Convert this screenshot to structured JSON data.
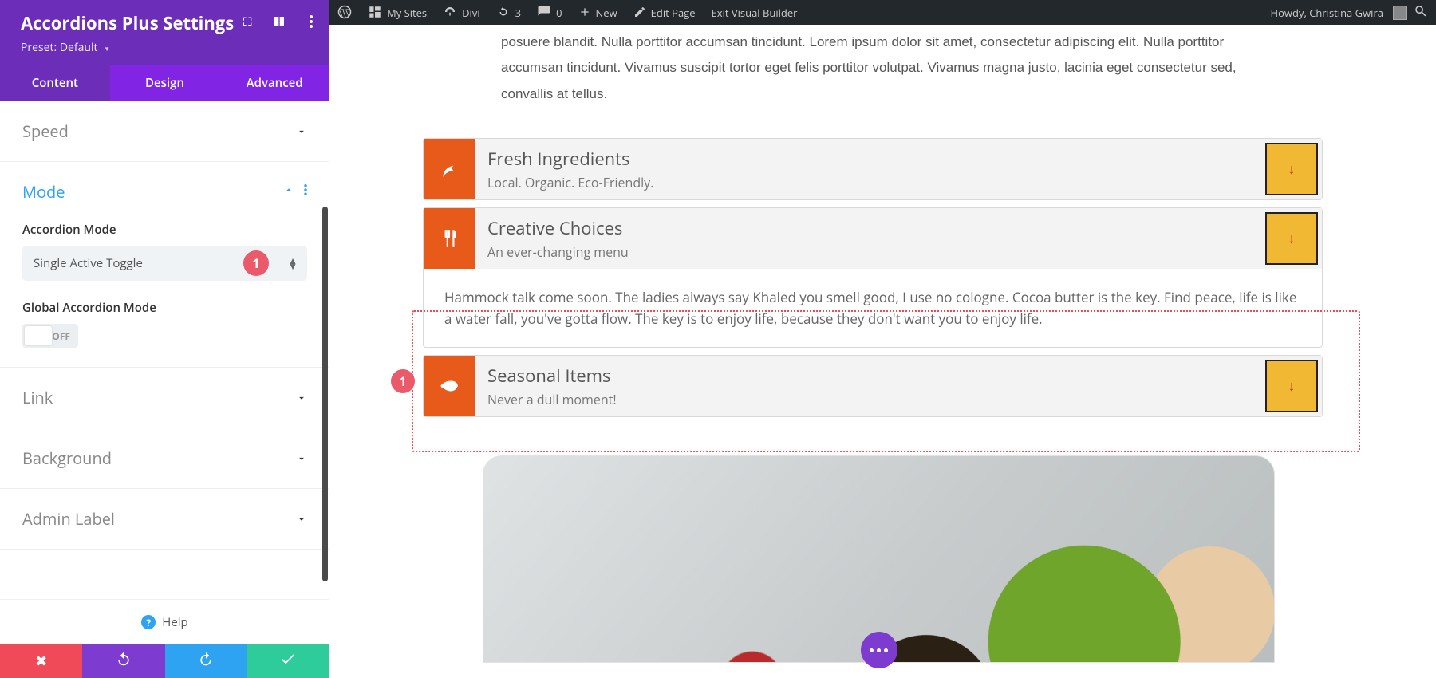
{
  "adminbar": {
    "mysites": "My Sites",
    "site": "Divi",
    "updates": "3",
    "comments": "0",
    "newlabel": "New",
    "editpage": "Edit Page",
    "exitvb": "Exit Visual Builder",
    "howdy": "Howdy, Christina Gwira"
  },
  "panel": {
    "title": "Accordions Plus Settings",
    "preset_label": "Preset:",
    "preset_value": "Default",
    "tabs": {
      "content": "Content",
      "design": "Design",
      "advanced": "Advanced"
    },
    "sections": {
      "speed": "Speed",
      "mode": "Mode",
      "link": "Link",
      "background": "Background",
      "adminlabel": "Admin Label"
    },
    "mode": {
      "field_label": "Accordion Mode",
      "select_value": "Single Active Toggle",
      "global_label": "Global Accordion Mode",
      "switch_off": "OFF",
      "marker": "1"
    },
    "help": "Help"
  },
  "preview": {
    "intro": "posuere blandit. Nulla porttitor accumsan tincidunt. Lorem ipsum dolor sit amet, consectetur adipiscing elit. Nulla porttitor accumsan tincidunt. Vivamus suscipit tortor eget felis porttitor volutpat. Vivamus magna justo, lacinia eget consectetur sed, convallis at tellus.",
    "marker": "1",
    "accordions": [
      {
        "icon": "leaf",
        "title": "Fresh Ingredients",
        "sub": "Local. Organic. Eco-Friendly.",
        "open": false
      },
      {
        "icon": "utensils",
        "title": "Creative Choices",
        "sub": "An ever-changing menu",
        "open": true,
        "body": "Hammock talk come soon. The ladies always say Khaled you smell good, I use no cologne. Cocoa butter is the key. Find peace, life is like a water fall, you've gotta flow. The key is to enjoy life, because they don't want you to enjoy life."
      },
      {
        "icon": "fish",
        "title": "Seasonal Items",
        "sub": "Never a dull moment!",
        "open": false
      }
    ]
  }
}
